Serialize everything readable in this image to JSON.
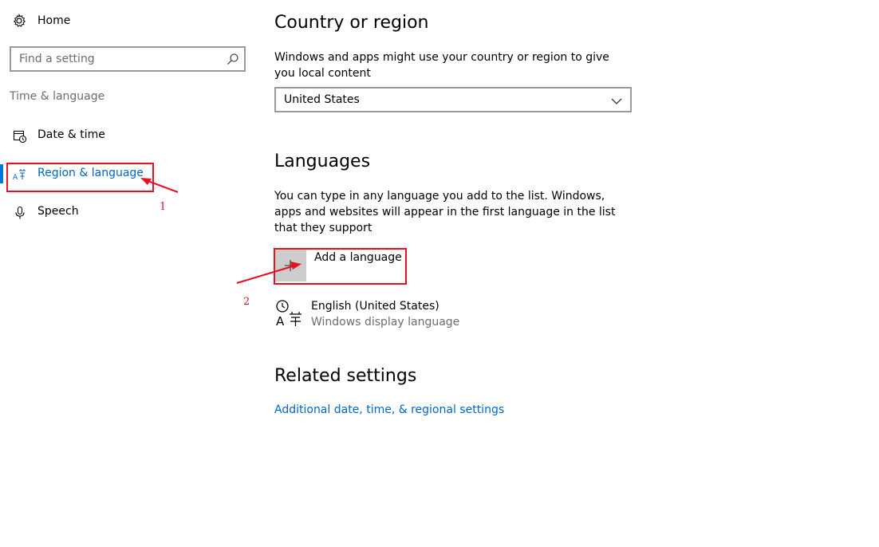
{
  "sidebar": {
    "home_label": "Home",
    "search_placeholder": "Find a setting",
    "section_title": "Time & language",
    "items": [
      {
        "label": "Date & time",
        "icon": "calendar-clock-icon",
        "selected": false
      },
      {
        "label": "Region & language",
        "icon": "region-language-icon",
        "selected": true
      },
      {
        "label": "Speech",
        "icon": "microphone-icon",
        "selected": false
      }
    ]
  },
  "main": {
    "country": {
      "title": "Country or region",
      "description": "Windows and apps might use your country or region to give you local content",
      "selected_value": "United States"
    },
    "languages": {
      "title": "Languages",
      "description": "You can type in any language you add to the list. Windows, apps and websites will appear in the first language in the list that they support",
      "add_label": "Add a language",
      "entries": [
        {
          "name": "English (United States)",
          "subtitle": "Windows display language"
        }
      ]
    },
    "related": {
      "title": "Related settings",
      "link": "Additional date, time, & regional settings"
    }
  },
  "annotations": {
    "marker_1": "1",
    "marker_2": "2",
    "color": "#e81123"
  },
  "colors": {
    "accent": "#0078d7",
    "link": "#0067c0",
    "secondary_text": "#6d6d6d"
  }
}
